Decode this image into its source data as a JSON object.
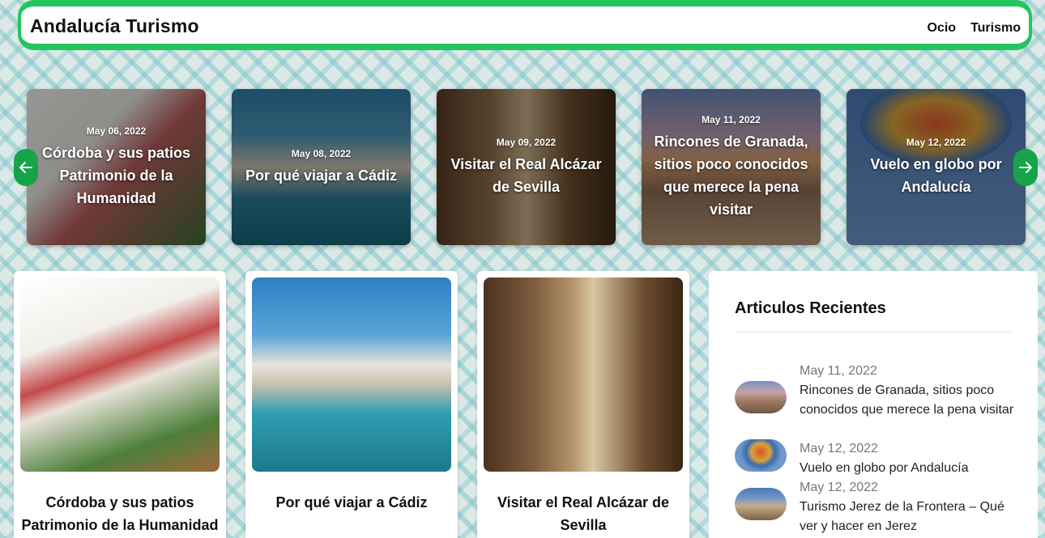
{
  "header": {
    "site_title": "Andalucía Turismo",
    "nav": [
      "Ocio",
      "Turismo"
    ]
  },
  "slider": {
    "slides": [
      {
        "date": "May 06, 2022",
        "title": "Córdoba y sus patios Patrimonio de la Humanidad"
      },
      {
        "date": "May 08, 2022",
        "title": "Por qué viajar a Cádiz"
      },
      {
        "date": "May 09, 2022",
        "title": "Visitar el Real Alcázar de Sevilla"
      },
      {
        "date": "May 11, 2022",
        "title": "Rincones de Granada, sitios poco conocidos que merece la pena visitar"
      },
      {
        "date": "May 12, 2022",
        "title": "Vuelo en globo por Andalucía"
      }
    ]
  },
  "posts": [
    {
      "title": "Córdoba y sus patios Patrimonio de la Humanidad"
    },
    {
      "title": "Por qué viajar a Cádiz"
    },
    {
      "title": "Visitar el Real Alcázar de Sevilla"
    }
  ],
  "sidebar": {
    "title": "Articulos Recientes",
    "items": [
      {
        "date": "May 11, 2022",
        "title": "Rincones de Granada, sitios poco conocidos que merece la pena visitar"
      },
      {
        "date": "May 12, 2022",
        "title": "Vuelo en globo por Andalucía"
      },
      {
        "date": "May 12, 2022",
        "title": "Turismo Jerez de la Frontera – Qué ver y hacer en Jerez"
      }
    ]
  },
  "colors": {
    "accent": "#22c55e",
    "arrow": "#16a34a"
  }
}
